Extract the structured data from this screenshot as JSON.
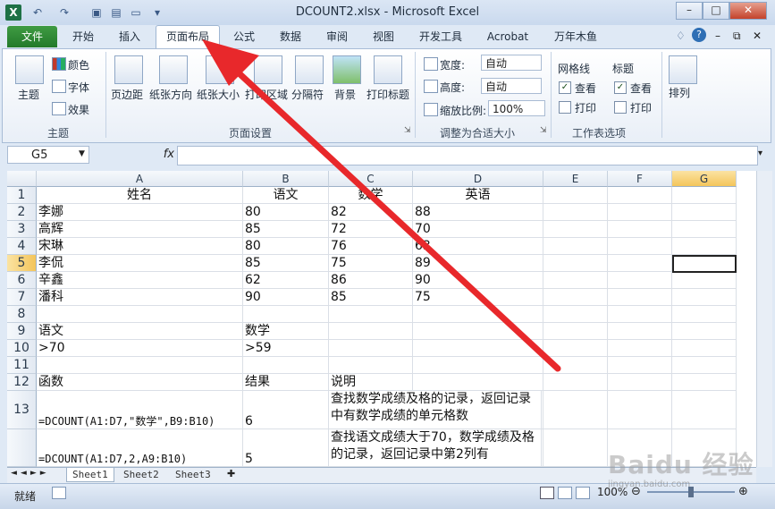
{
  "window": {
    "title": "DCOUNT2.xlsx - Microsoft Excel",
    "app_icon": "X"
  },
  "tabs": [
    "文件",
    "开始",
    "插入",
    "页面布局",
    "公式",
    "数据",
    "审阅",
    "视图",
    "开发工具",
    "Acrobat",
    "万年木鱼"
  ],
  "active_tab": "页面布局",
  "ribbon": {
    "theme_group": {
      "label": "主题",
      "theme_btn": "主题",
      "colors": "颜色",
      "fonts": "字体",
      "effects": "效果"
    },
    "page_setup_group": {
      "label": "页面设置",
      "margins": "页边距",
      "orientation": "纸张方向",
      "size": "纸张大小",
      "print_area": "打印区域",
      "breaks": "分隔符",
      "background": "背景",
      "print_titles": "打印标题"
    },
    "scale_group": {
      "label": "调整为合适大小",
      "width_label": "宽度:",
      "width_value": "自动",
      "height_label": "高度:",
      "height_value": "自动",
      "scale_label": "缩放比例:",
      "scale_value": "100%"
    },
    "sheet_options_group": {
      "label": "工作表选项",
      "gridlines": "网格线",
      "headings": "标题",
      "view": "查看",
      "print": "打印"
    },
    "arrange_group": {
      "label": "排列"
    }
  },
  "formula_bar": {
    "name_box": "G5",
    "fx": "fx",
    "formula": ""
  },
  "columns": [
    "A",
    "B",
    "C",
    "D",
    "E",
    "F",
    "G"
  ],
  "rows": [
    {
      "num": "1",
      "cells": [
        "姓名",
        "语文",
        "数学",
        "英语",
        "",
        "",
        ""
      ]
    },
    {
      "num": "2",
      "cells": [
        "李娜",
        "80",
        "82",
        "88",
        "",
        "",
        ""
      ]
    },
    {
      "num": "3",
      "cells": [
        "高辉",
        "85",
        "72",
        "70",
        "",
        "",
        ""
      ]
    },
    {
      "num": "4",
      "cells": [
        "宋琳",
        "80",
        "76",
        "63",
        "",
        "",
        ""
      ]
    },
    {
      "num": "5",
      "cells": [
        "李侃",
        "85",
        "75",
        "89",
        "",
        "",
        ""
      ]
    },
    {
      "num": "6",
      "cells": [
        "辛鑫",
        "62",
        "86",
        "90",
        "",
        "",
        ""
      ]
    },
    {
      "num": "7",
      "cells": [
        "潘科",
        "90",
        "85",
        "75",
        "",
        "",
        ""
      ]
    },
    {
      "num": "8",
      "cells": [
        "",
        "",
        "",
        "",
        "",
        "",
        ""
      ]
    },
    {
      "num": "9",
      "cells": [
        "语文",
        "数学",
        "",
        "",
        "",
        "",
        ""
      ]
    },
    {
      "num": "10",
      "cells": [
        ">70",
        ">59",
        "",
        "",
        "",
        "",
        ""
      ]
    },
    {
      "num": "11",
      "cells": [
        "",
        "",
        "",
        "",
        "",
        "",
        ""
      ]
    },
    {
      "num": "12",
      "cells": [
        "函数",
        "结果",
        "说明",
        "",
        "",
        "",
        ""
      ]
    },
    {
      "num": "13",
      "cells": [
        "=DCOUNT(A1:D7,\"数学\",B9:B10)",
        "6",
        "查找数学成绩及格的记录，返回记录中有数学成绩的单元格数",
        "",
        "",
        "",
        ""
      ]
    },
    {
      "num": "",
      "cells": [
        "=DCOUNT(A1:D7,2,A9:B10)",
        "5",
        "查找语文成绩大于70，数学成绩及格的记录，返回记录中第2列有",
        "",
        "",
        "",
        ""
      ]
    }
  ],
  "selected_cell": "G5",
  "sheets": [
    "Sheet1",
    "Sheet2",
    "Sheet3"
  ],
  "status": {
    "ready": "就绪",
    "zoom": "100%"
  },
  "watermark": {
    "text": "Baidu 经验",
    "sub": "jingyan.baidu.com"
  }
}
